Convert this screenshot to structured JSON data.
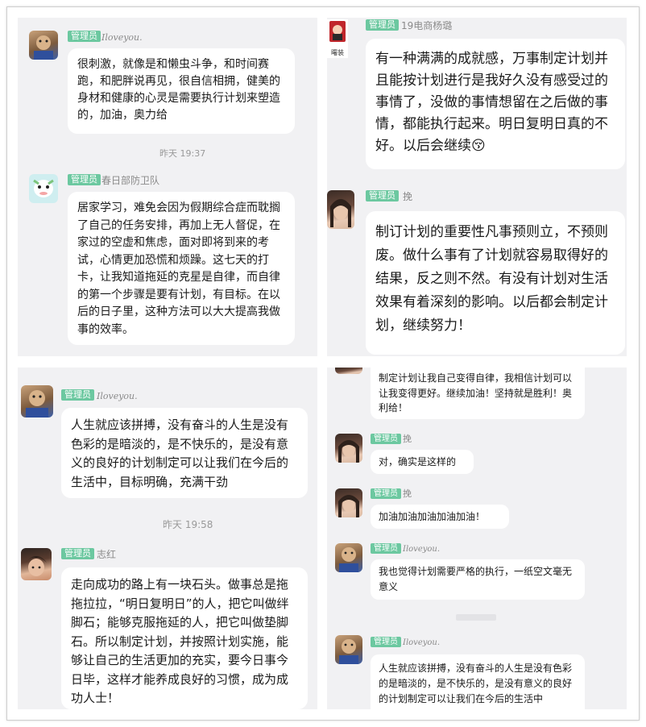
{
  "panel1": {
    "badge": "管理员",
    "name": "Iloveyou.",
    "message": "很刺激，就像是和懒虫斗争，和时间赛跑，和肥胖说再见，很自信相拥，健美的身材和健康的心灵是需要执行计划来塑造的，加油，奥力给",
    "time": "昨天 19:37",
    "badge2": "管理员",
    "name2": "春日部防卫队",
    "message2": "居家学习，难免会因为假期综合症而耽搁了自己的任务安排，再加上无人督促，在家过的空虚和焦虑，面对即将到来的考试，心情更加恐慌和烦躁。这七天的打卡，让我知道拖延的克星是自律，而自律的第一个步骤是要有计划，有目标。在以后的日子里，这种方法可以大大提高我做事的效率。"
  },
  "panel2": {
    "badge": "管理员",
    "name": "19电商杨璐",
    "avatar_text": "曙装",
    "message": "有一种满满的成就感，万事制定计划并且能按计划进行是我好久没有感受过的事情了，没做的事情想留在之后做的事情，都能执行起来。明日复明日真的不好。以后会继续",
    "emoji": "😚",
    "badge2": "管理员",
    "name2": "挽",
    "message2": "制订计划的重要性凡事预则立，不预则废。做什么事有了计划就容易取得好的结果，反之则不然。有没有计划对生活效果有着深刻的影响。以后都会制定计划，继续努力！"
  },
  "panel3": {
    "badge": "管理员",
    "name": "Iloveyou.",
    "message": "人生就应该拼搏，没有奋斗的人生是没有色彩的是暗淡的，是不快乐的，是没有意义的良好的计划制定可以让我们在今后的生活中，目标明确，充满干劲",
    "time": "昨天 19:58",
    "badge2": "管理员",
    "name2": "志红",
    "message2": "走向成功的路上有一块石头。做事总是拖拖拉拉，“明日复明日”的人，把它叫做绊脚石；能够克服拖延的人，把它叫做垫脚石。所以制定计划，并按照计划实施，能够让自己的生活更加的充实，要今日事今日毕，这样才能养成良好的习惯，成为成功人士！"
  },
  "panel4": {
    "message0": "制定计划让我自己变得自律，我相信计划可以让我变得更好。继续加油！坚持就是胜利！奥利给！",
    "badge1": "管理员",
    "name1": "挽",
    "message1": "对，确实是这样的",
    "badge2": "管理员",
    "name2": "挽",
    "message2": "加油加油加油加油加油！",
    "badge3": "管理员",
    "name3": "Iloveyou.",
    "message3": "我也觉得计划需要严格的执行，一纸空文毫无意义",
    "badge4": "管理员",
    "name4": "Iloveyou.",
    "message4": "人生就应该拼搏，没有奋斗的人生是没有色彩的是暗淡的，是不快乐的，是没有意义的良好的计划制定可以让我们在今后的生活中"
  },
  "colors": {
    "badge": "#6cc8a0",
    "panel_bg": "#f1f1f3",
    "bubble": "#ffffff"
  }
}
